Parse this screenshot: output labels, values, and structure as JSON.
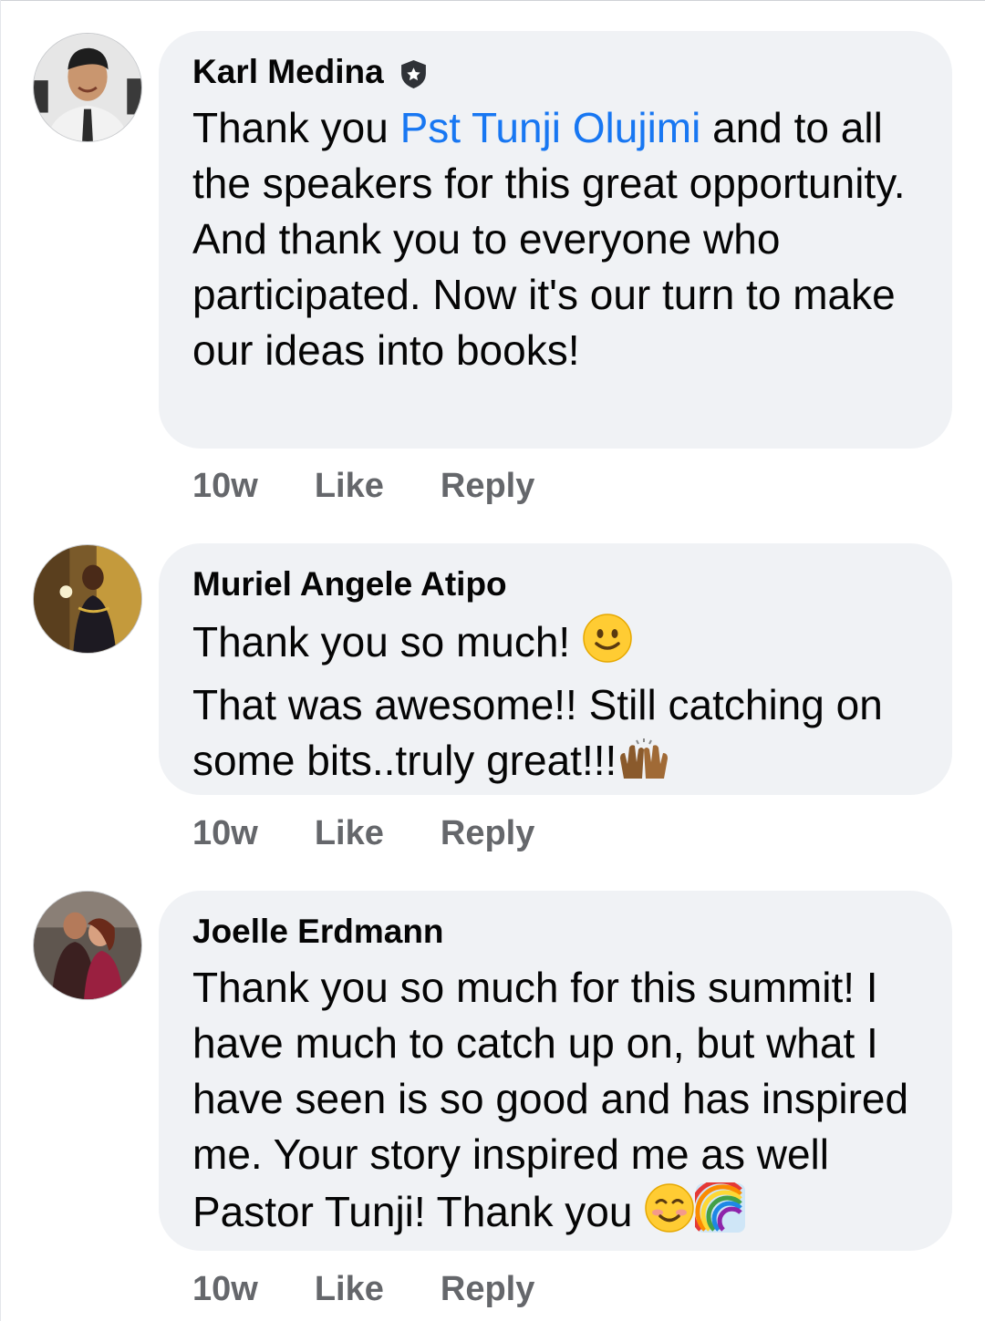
{
  "comments": [
    {
      "author": "Karl Medina",
      "badge": "shield-star-icon",
      "text_before": "Thank you ",
      "mention": "Pst Tunji Olujimi",
      "text_after": " and to all the speakers for this great opportunity. And thank you to everyone who participated. Now it's our turn to make our ideas into books!",
      "time": "10w",
      "like": "Like",
      "reply": "Reply"
    },
    {
      "author": "Muriel Angele Atipo",
      "line1": "Thank you so much! ",
      "line2": "That was awesome!! Still catching on some bits..truly great!!!",
      "emoji1": "slightly-smiling-face-icon",
      "emoji2": "raising-hands-icon",
      "time": "10w",
      "like": "Like",
      "reply": "Reply"
    },
    {
      "author": "Joelle Erdmann",
      "text": "Thank you so much for this summit! I have much to catch up on, but what I have seen is so good and has inspired me. Your story inspired me as well Pastor Tunji! Thank you ",
      "emoji1": "smiling-face-icon",
      "emoji2": "rainbow-icon",
      "time": "10w",
      "like": "Like",
      "reply": "Reply"
    }
  ],
  "colors": {
    "mention": "#1877f2",
    "bubble": "#f0f2f5",
    "meta": "#65676b"
  }
}
